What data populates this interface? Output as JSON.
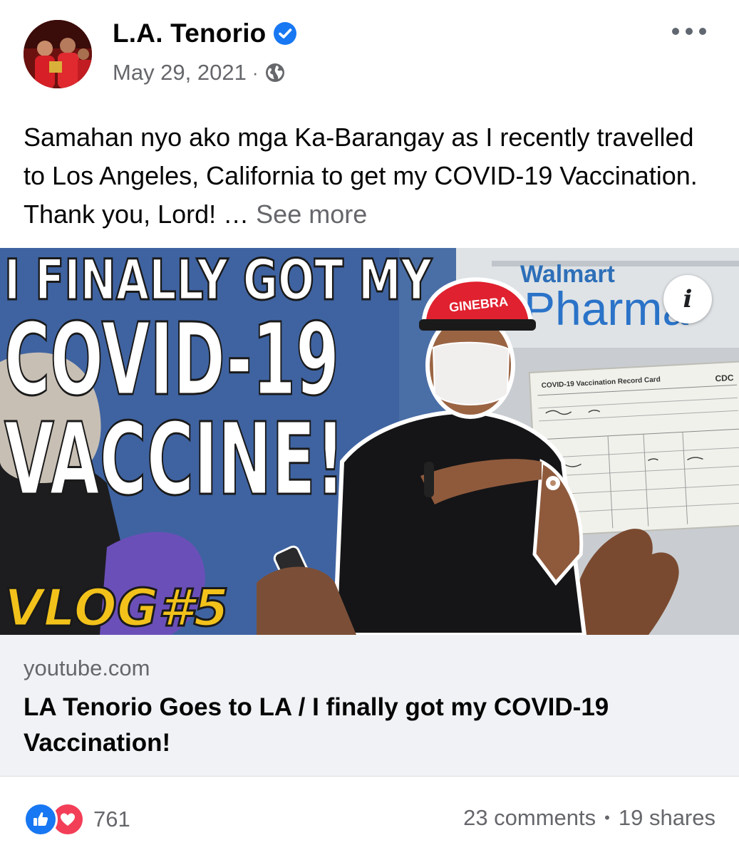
{
  "author": {
    "name": "L.A. Tenorio",
    "verified": true
  },
  "meta": {
    "date": "May 29, 2021",
    "separator": "·",
    "audience_icon": "globe-icon"
  },
  "menu": {
    "icon": "more-horizontal-icon"
  },
  "post": {
    "text": "Samahan nyo ako mga Ka-Barangay as I recently travelled to Los Angeles, California to get my COVID-19 Vaccination. Thank you, Lord! … ",
    "see_more": "See more"
  },
  "media": {
    "thumbnail_text": {
      "line1": "I FINALLY GOT MY",
      "line2": "COVID-19",
      "line3": "VACCINE!",
      "vlog_tag": "VLOG#5"
    },
    "cap_text": "GINEBRA",
    "store_sign": "Pharma",
    "store_brand": "Walmart",
    "card_title": "COVID-19 Vaccination Record Card",
    "card_logo": "CDC",
    "info_glyph": "i"
  },
  "link": {
    "domain": "youtube.com",
    "title": "LA Tenorio Goes to LA / I finally got my COVID-19 Vaccination!"
  },
  "footer": {
    "reaction_count": "761",
    "comments": "23 comments",
    "dot": "•",
    "shares": "19 shares"
  },
  "colors": {
    "accent": "#1877f2",
    "love": "#f33e58",
    "secondary_text": "#65676b",
    "link_bg": "#f0f2f5",
    "vlog_yellow": "#f2c21b"
  }
}
